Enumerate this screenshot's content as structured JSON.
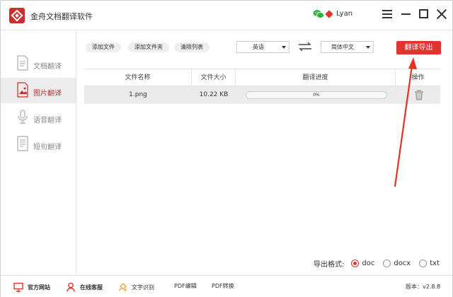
{
  "app": {
    "title": "金舟文档翻译软件",
    "username": "Lyan",
    "accent_color": "#e0342d"
  },
  "sidebar": {
    "items": [
      {
        "label": "文档翻译",
        "icon": "document-icon"
      },
      {
        "label": "图片翻译",
        "icon": "image-icon",
        "active": true
      },
      {
        "label": "语音翻译",
        "icon": "microphone-icon"
      },
      {
        "label": "短句翻译",
        "icon": "text-document-icon"
      }
    ]
  },
  "toolbar": {
    "add_file": "添加文件",
    "add_folder": "添加文件夹",
    "clear_list": "清除列表",
    "source_lang": "英语",
    "target_lang": "简体中文",
    "translate_export": "翻译导出"
  },
  "table": {
    "headers": {
      "name": "文件名称",
      "size": "文件大小",
      "progress": "翻译进度",
      "action": "操作"
    },
    "rows": [
      {
        "name": "1.png",
        "size": "10.22 KB",
        "progress_text": "0%",
        "progress_value": 0
      }
    ]
  },
  "export": {
    "label": "导出格式:",
    "options": [
      {
        "label": "doc",
        "checked": true
      },
      {
        "label": "docx",
        "checked": false
      },
      {
        "label": "txt",
        "checked": false
      }
    ]
  },
  "footer": {
    "website": "官方网站",
    "support": "在线客服",
    "ocr": "文字识别",
    "pdf_edit": "PDF编辑",
    "pdf_convert": "PDF转换",
    "version": "版本：v2.8.8"
  }
}
